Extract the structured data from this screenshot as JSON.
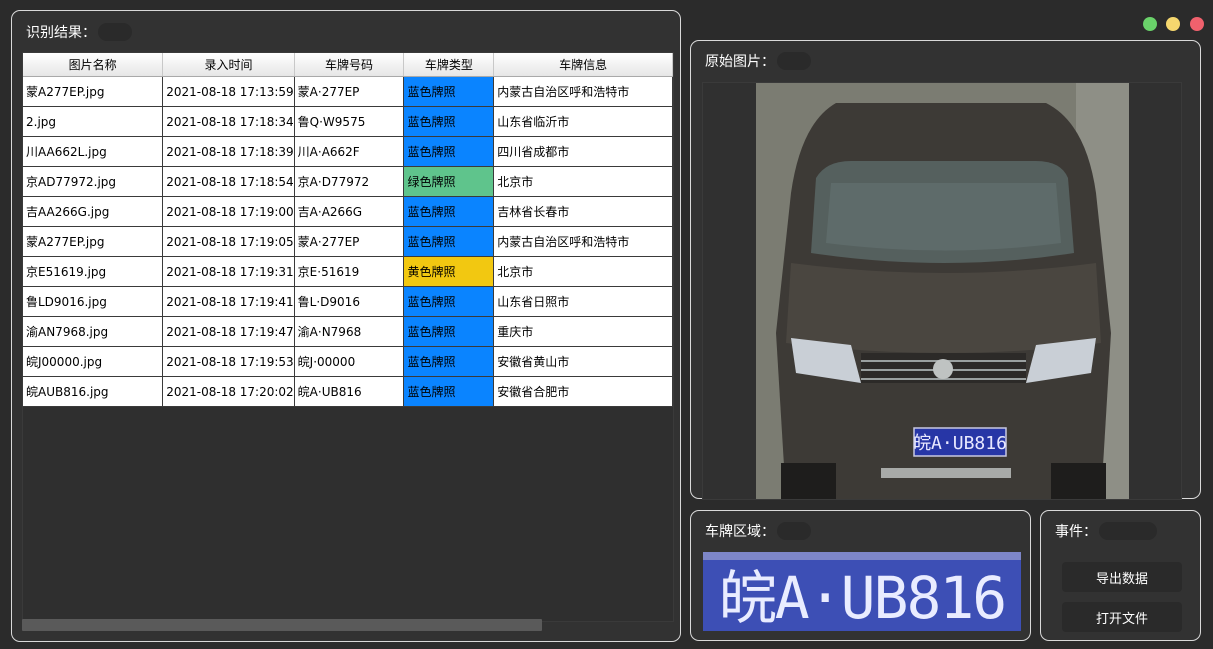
{
  "results": {
    "title": "识别结果：",
    "columns": [
      "图片名称",
      "录入时间",
      "车牌号码",
      "车牌类型",
      "车牌信息"
    ],
    "rows": [
      [
        "蒙A277EP.jpg",
        "2021-08-18 17:13:59",
        "蒙A·277EP",
        "蓝色牌照",
        "内蒙古自治区呼和浩特市"
      ],
      [
        "2.jpg",
        "2021-08-18 17:18:34",
        "鲁Q·W9575",
        "蓝色牌照",
        "山东省临沂市"
      ],
      [
        "川AA662L.jpg",
        "2021-08-18 17:18:39",
        "川A·A662F",
        "蓝色牌照",
        "四川省成都市"
      ],
      [
        "京AD77972.jpg",
        "2021-08-18 17:18:54",
        "京A·D77972",
        "绿色牌照",
        "北京市"
      ],
      [
        "吉AA266G.jpg",
        "2021-08-18 17:19:00",
        "吉A·A266G",
        "蓝色牌照",
        "吉林省长春市"
      ],
      [
        "蒙A277EP.jpg",
        "2021-08-18 17:19:05",
        "蒙A·277EP",
        "蓝色牌照",
        "内蒙古自治区呼和浩特市"
      ],
      [
        "京E51619.jpg",
        "2021-08-18 17:19:31",
        "京E·51619",
        "黄色牌照",
        "北京市"
      ],
      [
        "鲁LD9016.jpg",
        "2021-08-18 17:19:41",
        "鲁L·D9016",
        "蓝色牌照",
        "山东省日照市"
      ],
      [
        "渝AN7968.jpg",
        "2021-08-18 17:19:47",
        "渝A·N7968",
        "蓝色牌照",
        "重庆市"
      ],
      [
        "皖J00000.jpg",
        "2021-08-18 17:19:53",
        "皖J·00000",
        "蓝色牌照",
        "安徽省黄山市"
      ],
      [
        "皖AUB816.jpg",
        "2021-08-18 17:20:02",
        "皖A·UB816",
        "蓝色牌照",
        "安徽省合肥市"
      ]
    ],
    "type_colors": {
      "蓝色牌照": "#0a84ff",
      "绿色牌照": "#5fc48c",
      "黄色牌照": "#f2c811"
    }
  },
  "original": {
    "title": "原始图片：",
    "plate_text": "皖A·UB816"
  },
  "plate_region": {
    "title": "车牌区域：",
    "plate_text": "皖A·UB816"
  },
  "events": {
    "title": "事件：",
    "export_label": "导出数据",
    "open_label": "打开文件"
  },
  "window_controls": [
    {
      "name": "minimize",
      "color": "#6ad26a"
    },
    {
      "name": "maximize",
      "color": "#f5d76e"
    },
    {
      "name": "close",
      "color": "#f0616d"
    }
  ]
}
